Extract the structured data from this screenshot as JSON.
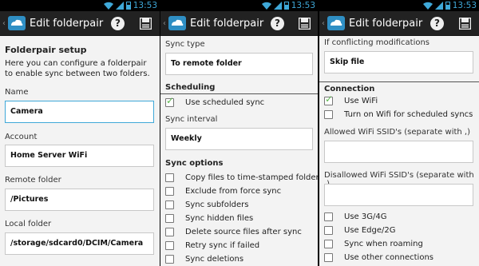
{
  "status_bar": {
    "time": "13:53"
  },
  "action_bar": {
    "title": "Edit folderpair"
  },
  "screen1": {
    "heading": "Folderpair setup",
    "description": "Here you can configure a folderpair to enable sync between two folders.",
    "name_label": "Name",
    "name_value": "Camera",
    "account_label": "Account",
    "account_value": "Home Server WiFi",
    "remote_label": "Remote folder",
    "remote_value": "/Pictures",
    "local_label": "Local folder",
    "local_value": "/storage/sdcard0/DCIM/Camera"
  },
  "screen2": {
    "sync_type_label": "Sync type",
    "sync_type_value": "To remote folder",
    "scheduling_header": "Scheduling",
    "use_scheduled_label": "Use scheduled sync",
    "use_scheduled_checked": true,
    "interval_label": "Sync interval",
    "interval_value": "Weekly",
    "options_header": "Sync options",
    "options": [
      {
        "label": "Copy files to time-stamped folder",
        "checked": false
      },
      {
        "label": "Exclude from force sync",
        "checked": false
      },
      {
        "label": "Sync subfolders",
        "checked": false
      },
      {
        "label": "Sync hidden files",
        "checked": false
      },
      {
        "label": "Delete source files after sync",
        "checked": false
      },
      {
        "label": "Retry sync if failed",
        "checked": false
      },
      {
        "label": "Sync deletions",
        "checked": false
      }
    ]
  },
  "screen3": {
    "conflict_label": "If conflicting modifications",
    "conflict_value": "Skip file",
    "connection_header": "Connection",
    "use_wifi_label": "Use WiFi",
    "use_wifi_checked": true,
    "turn_on_wifi_label": "Turn on Wifi for scheduled syncs",
    "turn_on_wifi_checked": false,
    "allowed_ssid_label": "Allowed WiFi SSID's (separate with ,)",
    "allowed_ssid_value": "",
    "disallowed_ssid_label": "Disallowed WiFi SSID's (separate with ,)",
    "disallowed_ssid_value": "",
    "options": [
      {
        "label": "Use 3G/4G",
        "checked": false
      },
      {
        "label": "Use Edge/2G",
        "checked": false
      },
      {
        "label": "Sync when roaming",
        "checked": false
      },
      {
        "label": "Use other connections",
        "checked": false
      }
    ]
  },
  "colors": {
    "accent": "#3fa8d8",
    "check": "#5bb84e",
    "action_bar": "#222222",
    "background": "#f3f3f3"
  }
}
